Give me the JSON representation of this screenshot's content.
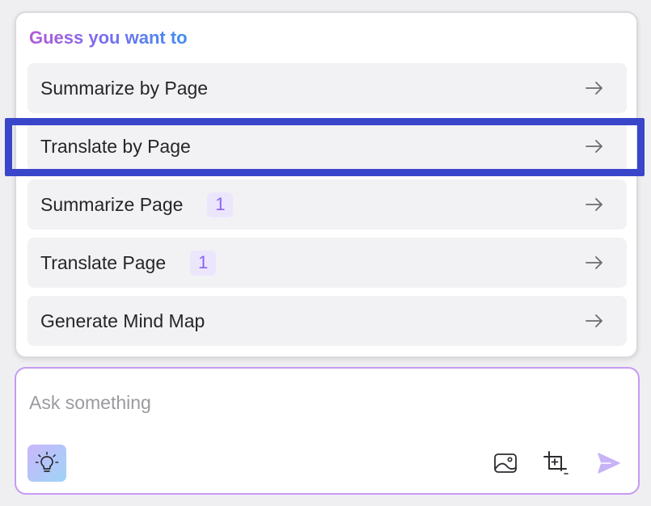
{
  "suggestions": {
    "title": "Guess you want to",
    "items": [
      {
        "label": "Summarize by Page",
        "badge": null
      },
      {
        "label": "Translate by Page",
        "badge": null
      },
      {
        "label": "Summarize Page",
        "badge": "1"
      },
      {
        "label": "Translate Page",
        "badge": "1"
      },
      {
        "label": "Generate Mind Map",
        "badge": null
      }
    ],
    "arrow_icon": "arrow-right-icon"
  },
  "input": {
    "placeholder": "Ask something",
    "value": ""
  },
  "toolbar": {
    "icons": [
      "lightbulb-icon",
      "image-icon",
      "crop-add-icon",
      "send-icon"
    ]
  },
  "colors": {
    "highlight": "#3a46c9",
    "accent": "#8b63f0",
    "badge_bg": "#ece6fd",
    "input_border": "#c69af2"
  }
}
